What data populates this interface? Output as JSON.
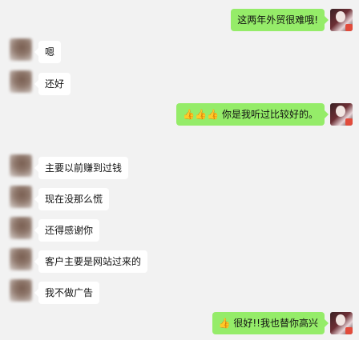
{
  "messages": [
    {
      "side": "out",
      "text": "这两年外贸很难哦!"
    },
    {
      "side": "in",
      "text": "嗯"
    },
    {
      "side": "in",
      "text": "还好"
    },
    {
      "side": "out",
      "emoji": "👍👍👍",
      "text": "你是我听过比较好的。"
    },
    {
      "side": "in",
      "text": "主要以前赚到过钱"
    },
    {
      "side": "in",
      "text": "现在没那么慌"
    },
    {
      "side": "in",
      "text": "还得感谢你"
    },
    {
      "side": "in",
      "text": "客户主要是网站过来的"
    },
    {
      "side": "in",
      "text": "我不做广告"
    },
    {
      "side": "out",
      "emoji": "👍",
      "text": "很好!!我也替你高兴"
    }
  ]
}
